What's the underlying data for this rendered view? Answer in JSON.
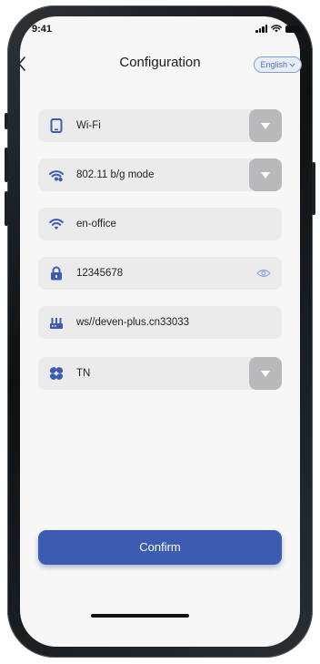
{
  "status_bar": {
    "time": "9:41"
  },
  "nav": {
    "title": "Configuration",
    "language": "English"
  },
  "form": {
    "connection_type": "Wi-Fi",
    "wifi_mode": "802.11 b/g mode",
    "ssid": "en-office",
    "password": "12345678",
    "server_url": "ws//deven-plus.cn33033",
    "network_type": "TN"
  },
  "confirm_label": "Confirm",
  "colors": {
    "accent": "#3b5cb0",
    "icon_blue": "#3b5cb0",
    "field_bg": "#ebebec",
    "dropdown_bg": "#b9b9bb"
  }
}
